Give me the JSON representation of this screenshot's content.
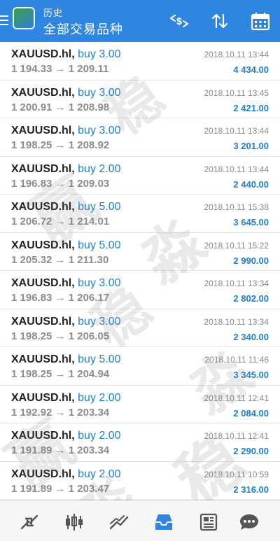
{
  "header": {
    "subtitle": "历史",
    "title": "全部交易品种",
    "bg_color": "#2f86e0"
  },
  "header_actions": [
    {
      "name": "currency-sort-icon"
    },
    {
      "name": "sort-arrows-icon"
    },
    {
      "name": "calendar-icon"
    }
  ],
  "trades": [
    {
      "symbol": "XAUUSD.hl",
      "sep": ",",
      "direction": "buy 3.00",
      "open": "1 194.33",
      "arrow": "→",
      "close": "1 209.11",
      "date": "2018.10.11 13:44",
      "profit": "4 434.00"
    },
    {
      "symbol": "XAUUSD.hl",
      "sep": ",",
      "direction": "buy 3.00",
      "open": "1 200.91",
      "arrow": "→",
      "close": "1 208.98",
      "date": "2018.10.11 13:45",
      "profit": "2 421.00"
    },
    {
      "symbol": "XAUUSD.hl",
      "sep": ",",
      "direction": "buy 3.00",
      "open": "1 198.25",
      "arrow": "→",
      "close": "1 208.92",
      "date": "2018.10.11 13:44",
      "profit": "3 201.00"
    },
    {
      "symbol": "XAUUSD.hl",
      "sep": ",",
      "direction": "buy 2.00",
      "open": "1 196.83",
      "arrow": "→",
      "close": "1 209.03",
      "date": "2018.10.11 13:44",
      "profit": "2 440.00"
    },
    {
      "symbol": "XAUUSD.hl",
      "sep": ",",
      "direction": "buy 5.00",
      "open": "1 206.72",
      "arrow": "→",
      "close": "1 214.01",
      "date": "2018.10.11 15:38",
      "profit": "3 645.00"
    },
    {
      "symbol": "XAUUSD.hl",
      "sep": ",",
      "direction": "buy 5.00",
      "open": "1 205.32",
      "arrow": "→",
      "close": "1 211.30",
      "date": "2018.10.11 15:22",
      "profit": "2 990.00"
    },
    {
      "symbol": "XAUUSD.hl",
      "sep": ",",
      "direction": "buy 3.00",
      "open": "1 196.83",
      "arrow": "→",
      "close": "1 206.17",
      "date": "2018.10.11 13:34",
      "profit": "2 802.00"
    },
    {
      "symbol": "XAUUSD.hl",
      "sep": ",",
      "direction": "buy 3.00",
      "open": "1 198.25",
      "arrow": "→",
      "close": "1 206.05",
      "date": "2018.10.11 13:34",
      "profit": "2 340.00"
    },
    {
      "symbol": "XAUUSD.hl",
      "sep": ",",
      "direction": "buy 5.00",
      "open": "1 198.25",
      "arrow": "→",
      "close": "1 204.94",
      "date": "2018.10.11 11:46",
      "profit": "3 345.00"
    },
    {
      "symbol": "XAUUSD.hl",
      "sep": ",",
      "direction": "buy 2.00",
      "open": "1 192.92",
      "arrow": "→",
      "close": "1 203.34",
      "date": "2018.10.11 12:41",
      "profit": "2 084.00"
    },
    {
      "symbol": "XAUUSD.hl",
      "sep": ",",
      "direction": "buy 2.00",
      "open": "1 191.89",
      "arrow": "→",
      "close": "1 203.34",
      "date": "2018.10.11 12:41",
      "profit": "2 290.00"
    },
    {
      "symbol": "XAUUSD.hl",
      "sep": ",",
      "direction": "buy 2.00",
      "open": "1 191.89",
      "arrow": "→",
      "close": "1 203.47",
      "date": "2018.10.11 10:59",
      "profit": "2 316.00"
    }
  ],
  "bottom_nav": [
    {
      "name": "quotes-icon",
      "active": false
    },
    {
      "name": "chart-candles-icon",
      "active": false
    },
    {
      "name": "trade-icon",
      "active": false
    },
    {
      "name": "history-inbox-icon",
      "active": true
    },
    {
      "name": "news-icon",
      "active": false
    },
    {
      "name": "chat-icon",
      "active": false
    }
  ],
  "colors": {
    "accent": "#1e7fd6",
    "muted": "#8c8c8c",
    "nav_icon": "#555555"
  },
  "watermark": [
    "稳",
    "赢",
    "淼",
    "稳",
    "淼",
    "赢",
    "稳",
    "淼"
  ]
}
